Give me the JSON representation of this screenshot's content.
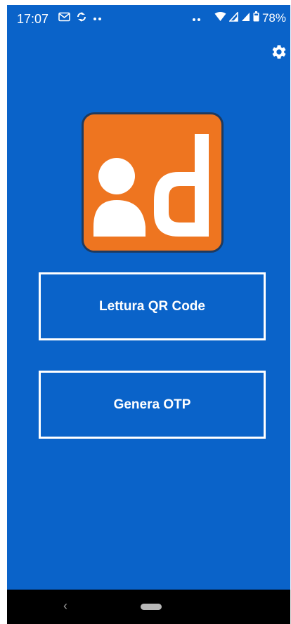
{
  "status_bar": {
    "time": "17:07",
    "left_icons": [
      "gmail-icon",
      "sync-icon",
      "more-dots-icon"
    ],
    "right_dots": "••",
    "right_icons": [
      "wifi-icon",
      "signal-icon",
      "signal-icon",
      "battery-icon"
    ],
    "battery": "78%"
  },
  "header": {
    "settings_icon": "gear-icon"
  },
  "logo": {
    "colors": {
      "background": "#ee7520",
      "border": "#1e3a5f",
      "glyph": "#ffffff"
    }
  },
  "actions": {
    "qr_label": "Lettura QR Code",
    "otp_label": "Genera OTP"
  },
  "nav_bar": {
    "back_glyph": "‹"
  },
  "colors": {
    "background": "#0a63c9",
    "button_border": "#ffffff",
    "nav_background": "#000000"
  }
}
